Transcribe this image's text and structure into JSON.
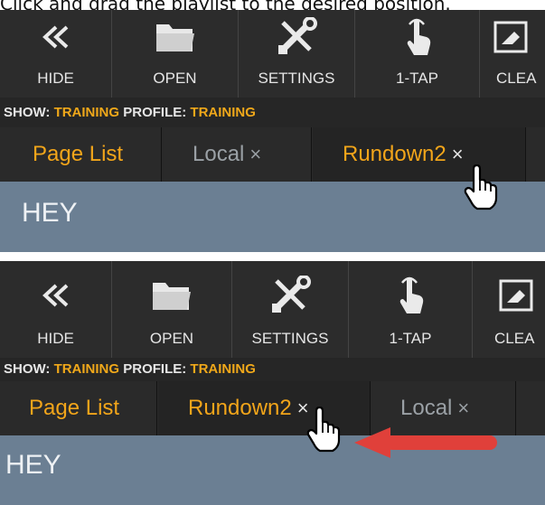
{
  "caption": "Click and drag the playlist to the desired position.",
  "toolbar": {
    "hide": "HIDE",
    "open": "OPEN",
    "settings": "SETTINGS",
    "one_tap": "1-TAP",
    "clear": "CLEA"
  },
  "info": {
    "show_label": "SHOW:",
    "show_value": "TRAINING",
    "profile_label": "PROFILE:",
    "profile_value": "TRAINING"
  },
  "tabs_before": [
    {
      "label": "Page List"
    },
    {
      "label": "Local",
      "close": "×"
    },
    {
      "label": "Rundown2",
      "close": "×"
    }
  ],
  "tabs_after": [
    {
      "label": "Page List"
    },
    {
      "label": "Rundown2",
      "close": "×"
    },
    {
      "label": "Local",
      "close": "×"
    }
  ],
  "content": {
    "text": "HEY"
  },
  "colors": {
    "accent_orange": "#f2a51a",
    "toolbar_bg": "#2c2c2c",
    "content_bg": "#6b7f93",
    "arrow_red": "#e0403a"
  }
}
